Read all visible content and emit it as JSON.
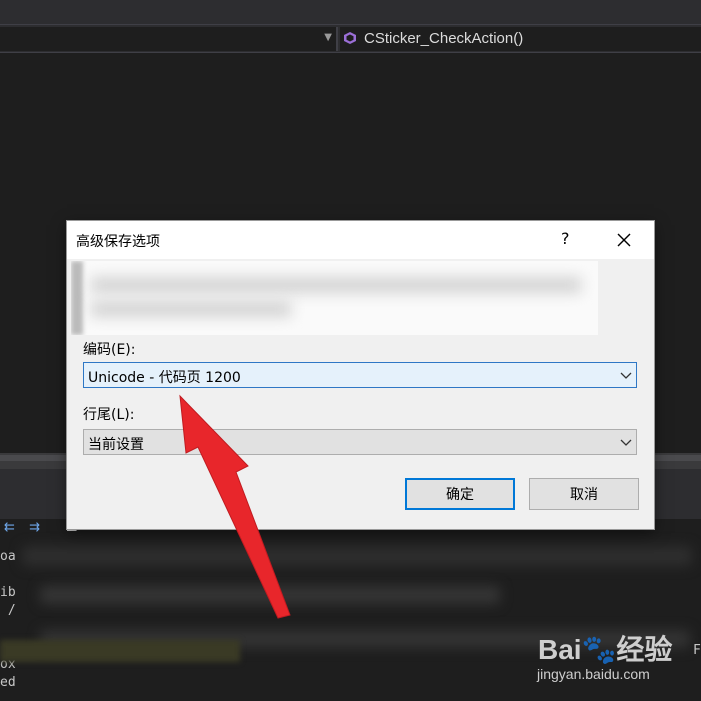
{
  "ide": {
    "nav_function_name": "CSticker_CheckAction()",
    "output_fragments": [
      "oa",
      "",
      "ib",
      " /",
      "",
      "",
      "ox",
      "ed"
    ],
    "output_right_char": "F"
  },
  "dialog": {
    "title": "高级保存选项",
    "help_label": "?",
    "encoding_label": "编码(E):",
    "encoding_value": "Unicode - 代码页 1200",
    "line_ending_label": "行尾(L):",
    "line_ending_value": "当前设置",
    "ok_label": "确定",
    "cancel_label": "取消"
  },
  "watermark": {
    "logo": "Bai🐾经验",
    "url": "jingyan.baidu.com"
  },
  "colors": {
    "accent": "#0078d7",
    "arrow": "#e8262b",
    "function_icon": "#9b6fd6"
  }
}
